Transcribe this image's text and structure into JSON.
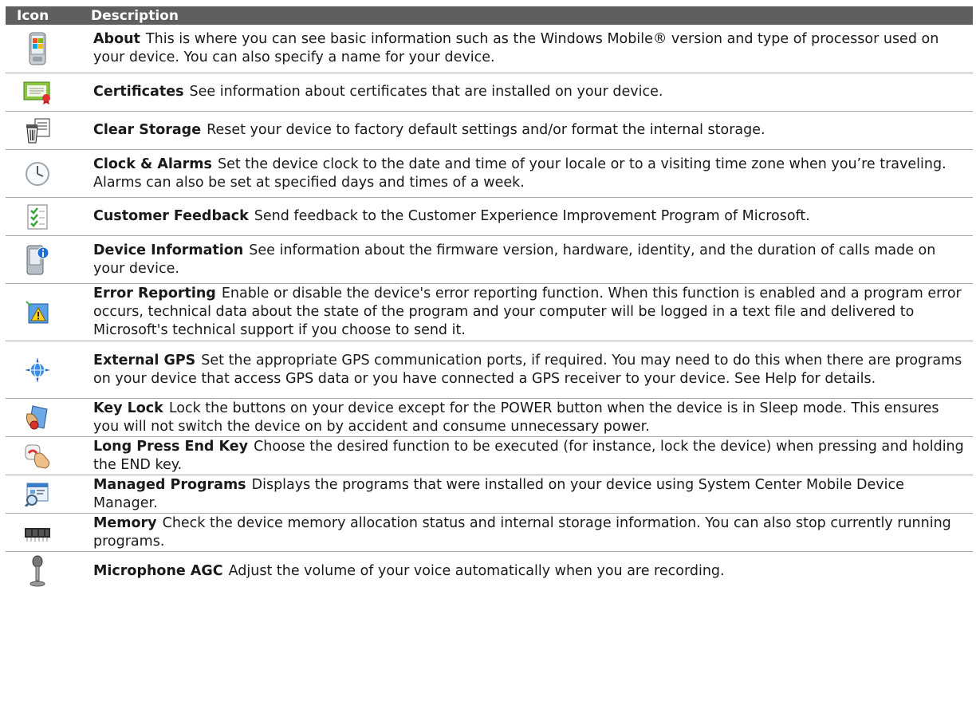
{
  "table": {
    "header": {
      "icon": "Icon",
      "description": "Description"
    },
    "rows": [
      {
        "icon": "device-flag-icon",
        "name": "About",
        "text": "This is where you can see basic information such as the Windows Mobile® version and type of processor used on your device. You can also specify a name for your device."
      },
      {
        "icon": "certificate-icon",
        "name": "Certificates",
        "text": "See information about certificates that are installed on your device."
      },
      {
        "icon": "trash-storage-icon",
        "name": "Clear Storage",
        "text": "Reset your device to factory default settings and/or format the internal storage."
      },
      {
        "icon": "clock-icon",
        "name": "Clock & Alarms",
        "text": "Set the device clock to the date and time of your locale or to a visiting time zone when you’re traveling. Alarms can also be set at specified days and times of a week."
      },
      {
        "icon": "checklist-icon",
        "name": "Customer Feedback",
        "text": "Send feedback to the Customer Experience Improvement Program of Microsoft."
      },
      {
        "icon": "device-info-icon",
        "name": "Device Information",
        "text": "See information about the firmware version, hardware, identity, and the duration of calls made on your device."
      },
      {
        "icon": "warning-icon",
        "name": "Error Reporting",
        "text": "Enable or disable the device's error reporting function. When this function is enabled and a program error occurs, technical data about the state of the program and your computer will be logged in a text file and delivered to Microsoft's technical support if you choose to send it."
      },
      {
        "icon": "gps-globe-icon",
        "name": "External GPS",
        "text": "Set the appropriate GPS communication ports, if required. You may need to do this when there are programs on your device that access GPS data or you have connected a GPS receiver to your device. See Help for details."
      },
      {
        "icon": "key-lock-icon",
        "name": "Key Lock",
        "text": "Lock the buttons on your device except for the POWER button when the device is in Sleep mode. This ensures you will not switch the device on by accident and consume unnecessary power."
      },
      {
        "icon": "end-key-press-icon",
        "name": "Long Press End Key",
        "text": "Choose the desired function to be executed (for instance, lock the device) when pressing and holding the END key."
      },
      {
        "icon": "managed-programs-icon",
        "name": "Managed Programs",
        "text": "Displays the programs that were installed on your device using System Center Mobile Device Manager."
      },
      {
        "icon": "memory-chip-icon",
        "name": "Memory",
        "text": "Check the device memory allocation status and internal storage information. You can also stop currently running programs."
      },
      {
        "icon": "microphone-icon",
        "name": "Microphone AGC",
        "text": "Adjust the volume of your voice automatically when you are recording."
      }
    ]
  }
}
